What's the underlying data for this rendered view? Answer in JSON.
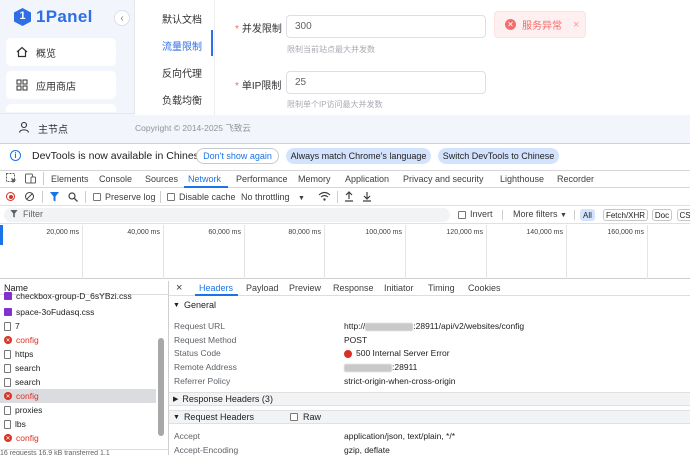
{
  "panel": {
    "brand": "1Panel",
    "sidebar": {
      "items": [
        {
          "label": "概览",
          "icon": "home-icon"
        },
        {
          "label": "应用商店",
          "icon": "grid-icon"
        }
      ],
      "node": {
        "label": "主节点",
        "icon": "user-icon"
      }
    },
    "submenu": [
      "默认文档",
      "流量限制",
      "反向代理",
      "负载均衡"
    ],
    "submenu_active": "流量限制",
    "form": {
      "concurrency_label": "并发限制",
      "concurrency_value": "300",
      "concurrency_hint": "限制当前站点最大并发数",
      "ip_label": "单IP限制",
      "ip_value": "25",
      "ip_hint": "限制单个IP访问最大并发数"
    },
    "alert": "服务异常",
    "copyright": "Copyright © 2014-2025 飞致云",
    "colors": {
      "accent": "#2f6fe6",
      "error": "#f56c6c"
    }
  },
  "devtools": {
    "info_bar": {
      "text": "DevTools is now available in Chinese",
      "btn_dont_show": "Don't show again",
      "btn_match": "Always match Chrome's language",
      "btn_switch": "Switch DevTools to Chinese"
    },
    "tabs": [
      "Elements",
      "Console",
      "Sources",
      "Network",
      "Performance",
      "Memory",
      "Application",
      "Privacy and security",
      "Lighthouse",
      "Recorder"
    ],
    "active_tab": "Network",
    "toolbar": {
      "preserve_log": "Preserve log",
      "disable_cache": "Disable cache",
      "throttling": "No throttling"
    },
    "filter": {
      "placeholder": "Filter",
      "invert": "Invert",
      "more_filters": "More filters",
      "chips": [
        "All",
        "Fetch/XHR",
        "Doc",
        "CS"
      ]
    },
    "timeline_ticks": [
      "20,000 ms",
      "40,000 ms",
      "60,000 ms",
      "80,000 ms",
      "100,000 ms",
      "120,000 ms",
      "140,000 ms",
      "160,000 ms"
    ],
    "request_list": {
      "header": "Name",
      "rows": [
        {
          "name": "checkbox-group-D_6sYBzi.css",
          "type": "css"
        },
        {
          "name": "space-3oFudasq.css",
          "type": "css"
        },
        {
          "name": "7",
          "type": "doc"
        },
        {
          "name": "config",
          "type": "error"
        },
        {
          "name": "https",
          "type": "doc"
        },
        {
          "name": "search",
          "type": "doc"
        },
        {
          "name": "search",
          "type": "doc"
        },
        {
          "name": "config",
          "type": "error",
          "selected": true
        },
        {
          "name": "proxies",
          "type": "doc"
        },
        {
          "name": "lbs",
          "type": "doc"
        },
        {
          "name": "config",
          "type": "error"
        }
      ],
      "status": "16 requests   16.9 kB transferred   1.1"
    },
    "detail": {
      "tabs": [
        "Headers",
        "Payload",
        "Preview",
        "Response",
        "Initiator",
        "Timing",
        "Cookies"
      ],
      "active_tab": "Headers",
      "general_title": "General",
      "general": [
        {
          "k": "Request URL",
          "v_prefix": "http://",
          "v_suffix": ":28911/api/v2/websites/config"
        },
        {
          "k": "Request Method",
          "v": "POST"
        },
        {
          "k": "Status Code",
          "v": "500 Internal Server Error"
        },
        {
          "k": "Remote Address",
          "v_suffix": ":28911"
        },
        {
          "k": "Referrer Policy",
          "v": "strict-origin-when-cross-origin"
        }
      ],
      "response_headers": "Response Headers (3)",
      "request_headers": "Request Headers",
      "raw": "Raw",
      "req": [
        {
          "k": "Accept",
          "v": "application/json, text/plain, */*"
        },
        {
          "k": "Accept-Encoding",
          "v": "gzip, deflate"
        }
      ]
    }
  }
}
